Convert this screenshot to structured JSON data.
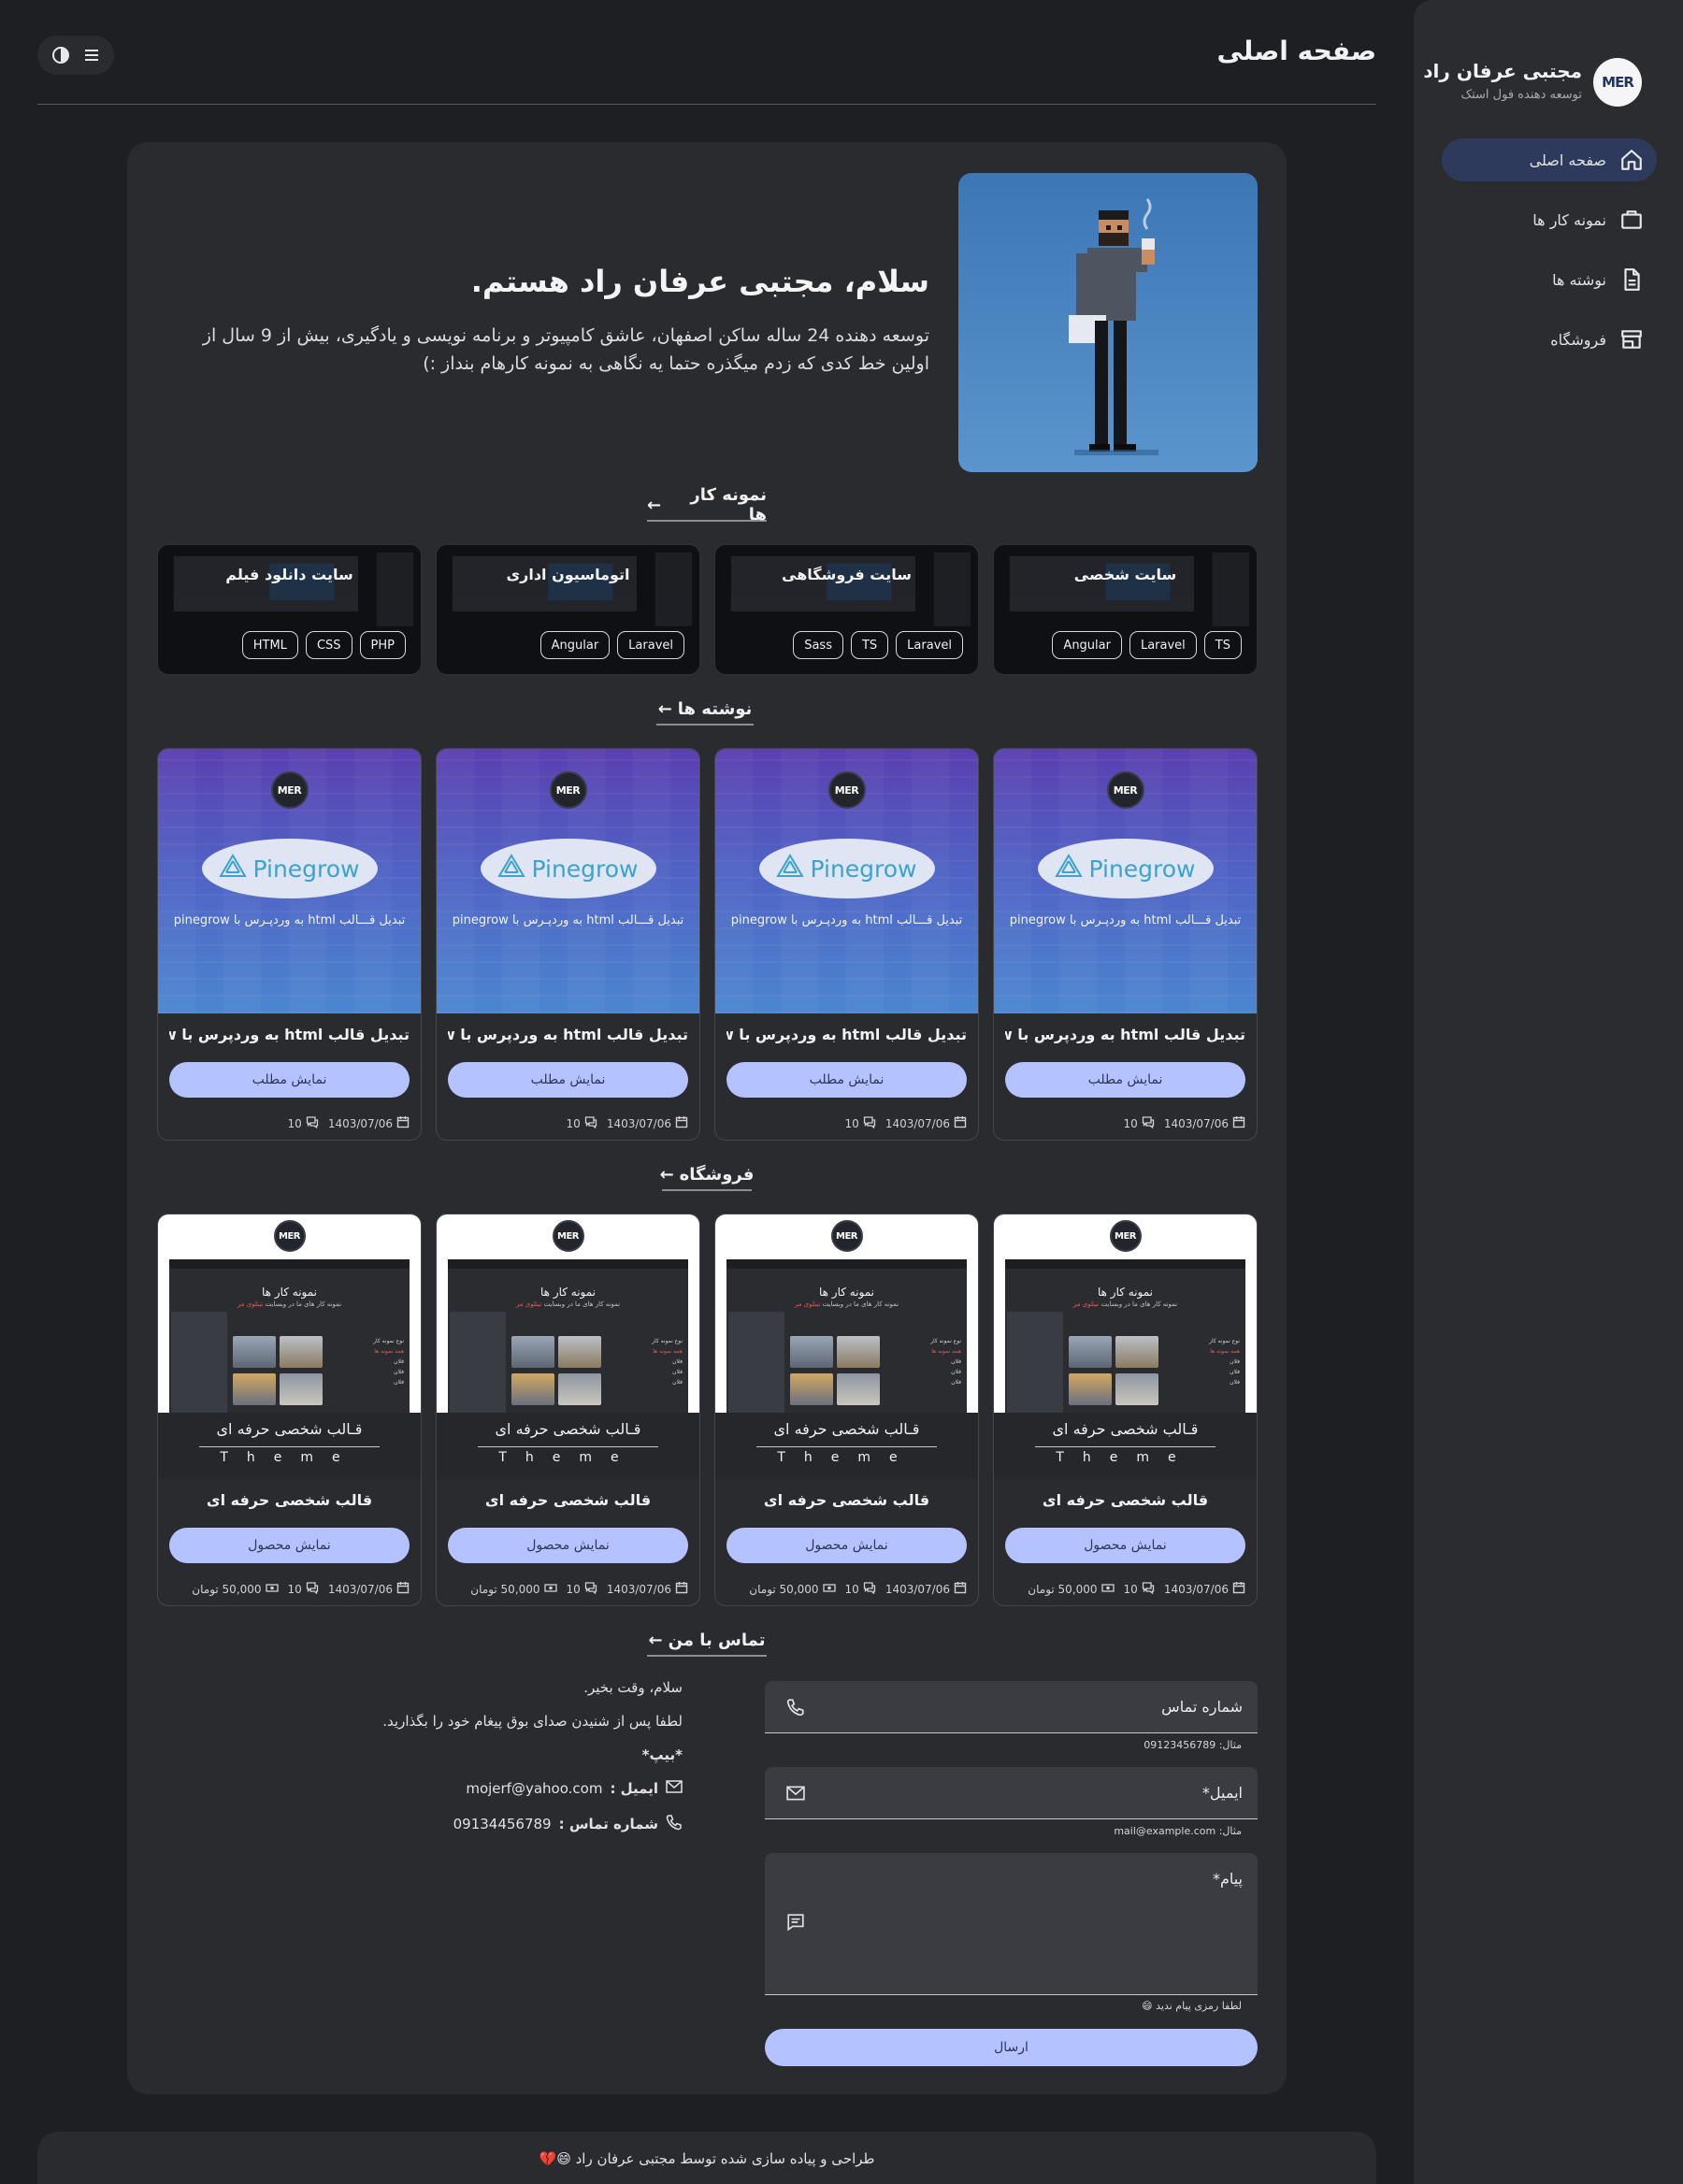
{
  "sidebar": {
    "logo_text": "MER",
    "name": "مجتبی عرفان راد",
    "role": "توسعه دهنده فول استک",
    "items": [
      {
        "label": "صفحه اصلی",
        "icon": "home-icon",
        "active": true
      },
      {
        "label": "نمونه کار ها",
        "icon": "briefcase-icon",
        "active": false
      },
      {
        "label": "نوشته ها",
        "icon": "document-icon",
        "active": false
      },
      {
        "label": "فروشگاه",
        "icon": "store-icon",
        "active": false
      }
    ]
  },
  "header": {
    "title": "صفحه اصلی",
    "tools": [
      "menu-icon",
      "theme-toggle-icon"
    ]
  },
  "hero": {
    "title": "سلام، مجتبی عرفان راد هستم.",
    "description": "توسعه دهنده 24 ساله ساکن اصفهان، عاشق کامپیوتر و برنامه نویسی و یادگیری، بیش از 9 سال از اولین خط کدی که زدم میگذره حتما یه نگاهی به نمونه کارهام بنداز :)"
  },
  "sections": {
    "portfolio": "نمونه کار ها",
    "blog": "نوشته ها",
    "shop": "فروشگاه",
    "contact": "تماس با من"
  },
  "portfolio": [
    {
      "title": "سایت شخصی",
      "tags": [
        "Angular",
        "Laravel",
        "TS"
      ]
    },
    {
      "title": "سایت فروشگاهی",
      "tags": [
        "Sass",
        "TS",
        "Laravel"
      ]
    },
    {
      "title": "اتوماسیون اداری",
      "tags": [
        "Angular",
        "Laravel"
      ]
    },
    {
      "title": "سایت دانلود فیلم",
      "tags": [
        "HTML",
        "CSS",
        "PHP"
      ]
    }
  ],
  "blog": {
    "badge": "MER",
    "image_brand": "Pinegrow",
    "image_caption": "تبدیل قـــالب html به وردپـرس با pinegrow",
    "button_label": "نمایش مطلب",
    "posts": [
      {
        "title": "تبدیل قالب html به وردپرس با pinegrow...",
        "date": "1403/07/06",
        "comments": "10"
      },
      {
        "title": "تبدیل قالب html به وردپرس با pinegrow...",
        "date": "1403/07/06",
        "comments": "10"
      },
      {
        "title": "تبدیل قالب html به وردپرس با pinegrow...",
        "date": "1403/07/06",
        "comments": "10"
      },
      {
        "title": "تبدیل قالب html به وردپرس با pinegrow...",
        "date": "1403/07/06",
        "comments": "10"
      }
    ]
  },
  "shop": {
    "badge": "MER",
    "shot_title": "نمونه کار ها",
    "shot_subtitle_prefix": "نمونه کار های ما در وبسایت",
    "shot_subtitle_highlight": "تیتلوی مر",
    "shot_side": [
      "نوع نمونه کار",
      "همه نمونه ها",
      "فلان",
      "فلان",
      "فلان"
    ],
    "band_title": "قـالب شخصی حرفه ای",
    "band_theme": "Theme",
    "button_label": "نمایش محصول",
    "products": [
      {
        "title": "قالب شخصی حرفه ای",
        "date": "1403/07/06",
        "comments": "10",
        "price": "50,000 تومان"
      },
      {
        "title": "قالب شخصی حرفه ای",
        "date": "1403/07/06",
        "comments": "10",
        "price": "50,000 تومان"
      },
      {
        "title": "قالب شخصی حرفه ای",
        "date": "1403/07/06",
        "comments": "10",
        "price": "50,000 تومان"
      },
      {
        "title": "قالب شخصی حرفه ای",
        "date": "1403/07/06",
        "comments": "10",
        "price": "50,000 تومان"
      }
    ]
  },
  "contact": {
    "greeting": "سلام، وقت بخیر.",
    "message": "لطفا پس از شنیدن صدای بوق پیغام خود را بگذارید.",
    "beep": "*بیپ*",
    "email_label": "ایمیل :",
    "email_value": "mojerf@yahoo.com",
    "phone_label": "شماره تماس :",
    "phone_value": "09134456789",
    "form": {
      "phone_label": "شماره تماس",
      "phone_hint": "مثال: 09123456789",
      "email_label": "ایمیل*",
      "email_hint": "مثال: mail@example.com",
      "message_label": "پیام*",
      "message_hint": "لطفا رمزی پیام ندید 😄",
      "submit_label": "ارسال"
    }
  },
  "footer": {
    "text": "طراحی و پیاده سازی شده توسط مجتبی عرفان راد 😄💔"
  },
  "colors": {
    "background": "#1e1f22",
    "panel": "#2a2b2f",
    "accent": "#b4c3ff",
    "nav_active": "#2e3a5c"
  }
}
